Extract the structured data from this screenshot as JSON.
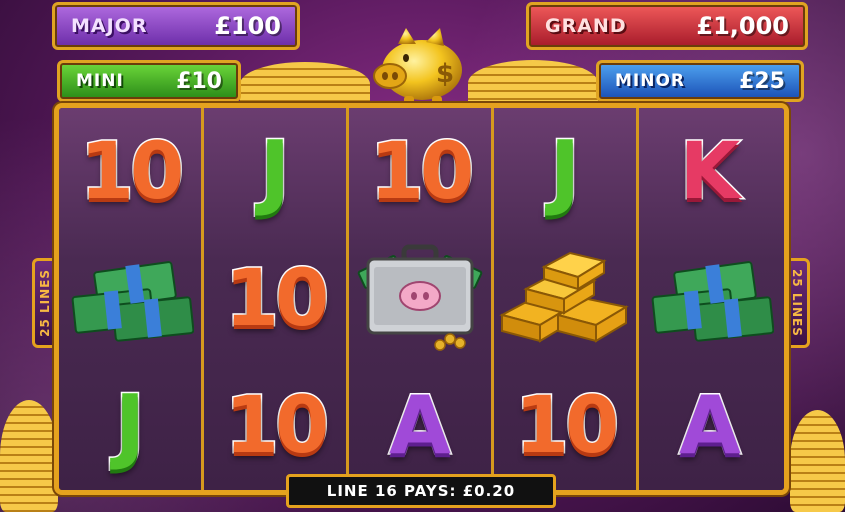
{
  "jackpots": {
    "major": {
      "label": "MAJOR",
      "value": "£100"
    },
    "grand": {
      "label": "GRAND",
      "value": "£1,000"
    },
    "mini": {
      "label": "MINI",
      "value": "£10"
    },
    "minor": {
      "label": "MINOR",
      "value": "£25"
    }
  },
  "reels": [
    {
      "symbols": [
        "10",
        "cash-stack",
        "J"
      ]
    },
    {
      "symbols": [
        "J",
        "10",
        "10"
      ]
    },
    {
      "symbols": [
        "10",
        "pig-briefcase",
        "A"
      ]
    },
    {
      "symbols": [
        "J",
        "gold-bars",
        "10"
      ]
    },
    {
      "symbols": [
        "K",
        "cash-stack",
        "A"
      ]
    }
  ],
  "side_labels": {
    "left": "25 LINES",
    "right": "25 LINES"
  },
  "status": {
    "pays_text": "LINE 16 PAYS: £0.20"
  },
  "icons": [
    "piggy-bank-icon",
    "coin-pile-icon",
    "cash-stack-icon",
    "briefcase-icon",
    "gold-bars-icon"
  ]
}
